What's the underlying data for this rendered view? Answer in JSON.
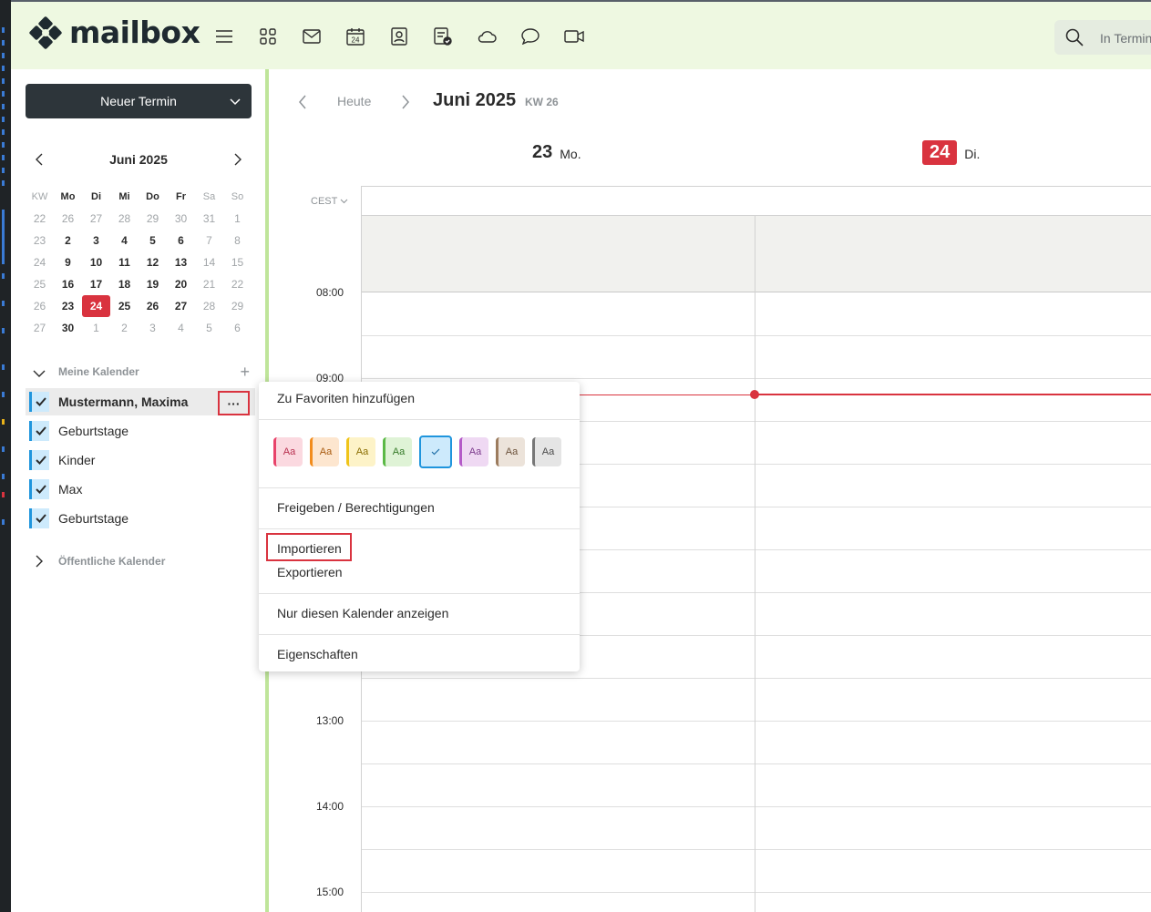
{
  "app": {
    "brand": "mailbox",
    "search_placeholder": "In Termin"
  },
  "toolbar": {
    "icons": [
      "menu-icon",
      "apps-grid-icon",
      "mail-icon",
      "calendar-icon",
      "contacts-icon",
      "tasks-icon",
      "cloud-icon",
      "chat-icon",
      "video-icon"
    ],
    "calendar_icon_day": "24"
  },
  "sidebar": {
    "new_button": "Neuer Termin",
    "mini_month": "Juni 2025",
    "week_headers": [
      "KW",
      "Mo",
      "Di",
      "Mi",
      "Do",
      "Fr",
      "Sa",
      "So"
    ],
    "weeks": [
      [
        "22",
        "26",
        "27",
        "28",
        "29",
        "30",
        "31",
        "1"
      ],
      [
        "23",
        "2",
        "3",
        "4",
        "5",
        "6",
        "7",
        "8"
      ],
      [
        "24",
        "9",
        "10",
        "11",
        "12",
        "13",
        "14",
        "15"
      ],
      [
        "25",
        "16",
        "17",
        "18",
        "19",
        "20",
        "21",
        "22"
      ],
      [
        "26",
        "23",
        "24",
        "25",
        "26",
        "27",
        "28",
        "29"
      ],
      [
        "27",
        "30",
        "1",
        "2",
        "3",
        "4",
        "5",
        "6"
      ]
    ],
    "today": "24",
    "my_calendars_label": "Meine Kalender",
    "calendars": [
      {
        "name": "Mustermann, Maxima",
        "checked": true
      },
      {
        "name": "Geburtstage",
        "checked": true
      },
      {
        "name": "Kinder",
        "checked": true
      },
      {
        "name": "Max",
        "checked": true
      },
      {
        "name": "Geburtstage",
        "checked": true
      }
    ],
    "more_label": "···",
    "public_calendars_label": "Öffentliche Kalender"
  },
  "main": {
    "today_label": "Heute",
    "period_title": "Juni 2025",
    "week_label": "KW 26",
    "timezone": "CEST",
    "days": [
      {
        "num": "23",
        "name": "Mo.",
        "today": false
      },
      {
        "num": "24",
        "name": "Di.",
        "today": true
      }
    ],
    "times": [
      "08:00",
      "09:00",
      "13:00",
      "14:00",
      "15:00"
    ]
  },
  "context_menu": {
    "add_favorite": "Zu Favoriten hinzufügen",
    "swatch_label": "Aa",
    "swatches": [
      {
        "bg": "#fbd9e0",
        "border": "#e8436a",
        "text": "#b8304f"
      },
      {
        "bg": "#fde6cf",
        "border": "#f28c1c",
        "text": "#a85a0f"
      },
      {
        "bg": "#fdf3c8",
        "border": "#f0c419",
        "text": "#8a6d00"
      },
      {
        "bg": "#dff3d6",
        "border": "#5bb946",
        "text": "#357a28"
      },
      {
        "bg": "#cdeafc",
        "border": "#1f95dd",
        "text": "#1f6fa8",
        "selected": true
      },
      {
        "bg": "#efd9f3",
        "border": "#b45ac8",
        "text": "#7b3a8c"
      },
      {
        "bg": "#ece3da",
        "border": "#9c7c5e",
        "text": "#6b513a"
      },
      {
        "bg": "#e5e5e5",
        "border": "#777777",
        "text": "#4a4a4a"
      }
    ],
    "share": "Freigeben / Berechtigungen",
    "import": "Importieren",
    "export": "Exportieren",
    "only_this": "Nur diesen Kalender anzeigen",
    "properties": "Eigenschaften"
  },
  "colors": {
    "header_bg": "#eef8e1",
    "accent_red": "#d9333f",
    "accent_blue": "#1f95dd",
    "button_dark": "#2d353a",
    "sidebar_divider": "#bfe59a"
  }
}
